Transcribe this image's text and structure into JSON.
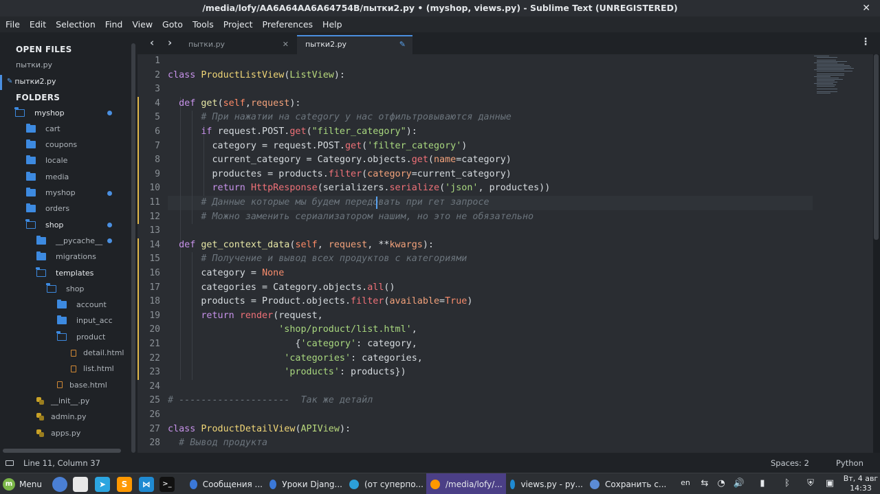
{
  "window": {
    "title": "/media/lofy/AA6A64AA6A64754B/пытки2.py • (myshop, views.py) - Sublime Text (UNREGISTERED)",
    "close_glyph": "✕"
  },
  "menu": [
    "File",
    "Edit",
    "Selection",
    "Find",
    "View",
    "Goto",
    "Tools",
    "Project",
    "Preferences",
    "Help"
  ],
  "sidebar": {
    "open_files_header": "OPEN FILES",
    "open_files": [
      {
        "label": "пытки.ру",
        "active": false
      },
      {
        "label": "пытки2.ру",
        "active": true
      }
    ],
    "folders_header": "FOLDERS",
    "tree": [
      {
        "label": "myshop",
        "type": "folder-open",
        "depth": 0,
        "dot": true
      },
      {
        "label": "cart",
        "type": "folder",
        "depth": 1,
        "dot": false
      },
      {
        "label": "coupons",
        "type": "folder",
        "depth": 1,
        "dot": false
      },
      {
        "label": "locale",
        "type": "folder",
        "depth": 1,
        "dot": false
      },
      {
        "label": "media",
        "type": "folder",
        "depth": 1,
        "dot": false
      },
      {
        "label": "myshop",
        "type": "folder",
        "depth": 1,
        "dot": true
      },
      {
        "label": "orders",
        "type": "folder",
        "depth": 1,
        "dot": false
      },
      {
        "label": "shop",
        "type": "folder-open",
        "depth": 1,
        "dot": true
      },
      {
        "label": "__pycache__",
        "type": "folder",
        "depth": 2,
        "dot": true
      },
      {
        "label": "migrations",
        "type": "folder",
        "depth": 2,
        "dot": false
      },
      {
        "label": "templates",
        "type": "folder-open",
        "depth": 2,
        "dot": false
      },
      {
        "label": "shop",
        "type": "folder-open",
        "depth": 3,
        "dot": false
      },
      {
        "label": "account",
        "type": "folder",
        "depth": 4,
        "dot": false
      },
      {
        "label": "input_acc",
        "type": "folder",
        "depth": 4,
        "dot": false
      },
      {
        "label": "product",
        "type": "folder-open",
        "depth": 4,
        "dot": false
      },
      {
        "label": "detail.html",
        "type": "html",
        "depth": 5,
        "dot": false
      },
      {
        "label": "list.html",
        "type": "html",
        "depth": 5,
        "dot": false
      },
      {
        "label": "base.html",
        "type": "html",
        "depth": 4,
        "dot": false
      },
      {
        "label": "__init__.py",
        "type": "py",
        "depth": 2,
        "dot": false
      },
      {
        "label": "admin.py",
        "type": "py",
        "depth": 2,
        "dot": false
      },
      {
        "label": "apps.py",
        "type": "py",
        "depth": 2,
        "dot": false
      }
    ]
  },
  "tabs": [
    {
      "label": "пытки.ру",
      "active": false
    },
    {
      "label": "пытки2.ру",
      "active": true
    }
  ],
  "editor": {
    "current_line": 11,
    "modified_lines": [
      4,
      5,
      6,
      7,
      8,
      9,
      10,
      11,
      12,
      14,
      15,
      16,
      17,
      18,
      19,
      20,
      21,
      22,
      23
    ],
    "lines": [
      {
        "n": 1,
        "tokens": []
      },
      {
        "n": 2,
        "tokens": [
          [
            "kw",
            "class "
          ],
          [
            "cls",
            "ProductListView"
          ],
          [
            "op",
            "("
          ],
          [
            "cls2",
            "ListView"
          ],
          [
            "op",
            "):"
          ]
        ]
      },
      {
        "n": 3,
        "tokens": []
      },
      {
        "n": 4,
        "tokens": [
          [
            "op",
            "  "
          ],
          [
            "kw",
            "def "
          ],
          [
            "fn",
            "get"
          ],
          [
            "op",
            "("
          ],
          [
            "self",
            "self"
          ],
          [
            "op",
            ","
          ],
          [
            "param",
            "request"
          ],
          [
            "op",
            "):"
          ]
        ]
      },
      {
        "n": 5,
        "tokens": [
          [
            "op",
            "      "
          ],
          [
            "cmt",
            "# При нажатии на category у нас отфильтровываются данные"
          ]
        ]
      },
      {
        "n": 6,
        "tokens": [
          [
            "op",
            "      "
          ],
          [
            "kw",
            "if "
          ],
          [
            "op",
            "request.POST."
          ],
          [
            "call",
            "get"
          ],
          [
            "op",
            "("
          ],
          [
            "str",
            "\"filter_category\""
          ],
          [
            "op",
            "):"
          ]
        ]
      },
      {
        "n": 7,
        "tokens": [
          [
            "op",
            "        category = request.POST."
          ],
          [
            "call",
            "get"
          ],
          [
            "op",
            "("
          ],
          [
            "str",
            "'filter_category'"
          ],
          [
            "op",
            ")"
          ]
        ]
      },
      {
        "n": 8,
        "tokens": [
          [
            "op",
            "        current_category = Category.objects."
          ],
          [
            "call",
            "get"
          ],
          [
            "op",
            "("
          ],
          [
            "param",
            "name"
          ],
          [
            "op",
            "=category)"
          ]
        ]
      },
      {
        "n": 9,
        "tokens": [
          [
            "op",
            "        productes = products."
          ],
          [
            "call",
            "filter"
          ],
          [
            "op",
            "("
          ],
          [
            "param",
            "category"
          ],
          [
            "op",
            "=current_category)"
          ]
        ]
      },
      {
        "n": 10,
        "tokens": [
          [
            "op",
            "        "
          ],
          [
            "kw",
            "return "
          ],
          [
            "call",
            "HttpResponse"
          ],
          [
            "op",
            "(serializers."
          ],
          [
            "call",
            "serialize"
          ],
          [
            "op",
            "("
          ],
          [
            "str",
            "'json'"
          ],
          [
            "op",
            ", productes))"
          ]
        ]
      },
      {
        "n": 11,
        "tokens": [
          [
            "op",
            "      "
          ],
          [
            "cmt",
            "# Данные которые мы будем передовать при гет запросе"
          ]
        ]
      },
      {
        "n": 12,
        "tokens": [
          [
            "op",
            "      "
          ],
          [
            "cmt",
            "# Можно заменить сериализатором нашим, но это не обязательно"
          ]
        ]
      },
      {
        "n": 13,
        "tokens": []
      },
      {
        "n": 14,
        "tokens": [
          [
            "op",
            "  "
          ],
          [
            "kw",
            "def "
          ],
          [
            "fn",
            "get_context_data"
          ],
          [
            "op",
            "("
          ],
          [
            "self",
            "self"
          ],
          [
            "op",
            ", "
          ],
          [
            "param",
            "request"
          ],
          [
            "op",
            ", **"
          ],
          [
            "param",
            "kwargs"
          ],
          [
            "op",
            "):"
          ]
        ]
      },
      {
        "n": 15,
        "tokens": [
          [
            "op",
            "      "
          ],
          [
            "cmt",
            "# Получение и вывод всех продуктов с категориями"
          ]
        ]
      },
      {
        "n": 16,
        "tokens": [
          [
            "op",
            "      category = "
          ],
          [
            "const",
            "None"
          ]
        ]
      },
      {
        "n": 17,
        "tokens": [
          [
            "op",
            "      categories = Category.objects."
          ],
          [
            "call",
            "all"
          ],
          [
            "op",
            "()"
          ]
        ]
      },
      {
        "n": 18,
        "tokens": [
          [
            "op",
            "      products = Product.objects."
          ],
          [
            "call",
            "filter"
          ],
          [
            "op",
            "("
          ],
          [
            "param",
            "available"
          ],
          [
            "op",
            "="
          ],
          [
            "const",
            "True"
          ],
          [
            "op",
            ")"
          ]
        ]
      },
      {
        "n": 19,
        "tokens": [
          [
            "op",
            "      "
          ],
          [
            "kw",
            "return "
          ],
          [
            "call",
            "render"
          ],
          [
            "op",
            "(request,"
          ]
        ]
      },
      {
        "n": 20,
        "tokens": [
          [
            "op",
            "                    "
          ],
          [
            "str",
            "'shop/product/list.html'"
          ],
          [
            "op",
            ","
          ]
        ]
      },
      {
        "n": 21,
        "tokens": [
          [
            "op",
            "                       {"
          ],
          [
            "str",
            "'category'"
          ],
          [
            "op",
            ": category,"
          ]
        ]
      },
      {
        "n": 22,
        "tokens": [
          [
            "op",
            "                     "
          ],
          [
            "str",
            "'categories'"
          ],
          [
            "op",
            ": categories,"
          ]
        ]
      },
      {
        "n": 23,
        "tokens": [
          [
            "op",
            "                     "
          ],
          [
            "str",
            "'products'"
          ],
          [
            "op",
            ": products})"
          ]
        ]
      },
      {
        "n": 24,
        "tokens": []
      },
      {
        "n": 25,
        "tokens": [
          [
            "cmt",
            "# --------------------  Так же детайл"
          ]
        ]
      },
      {
        "n": 26,
        "tokens": []
      },
      {
        "n": 27,
        "tokens": [
          [
            "kw",
            "class "
          ],
          [
            "cls",
            "ProductDetailView"
          ],
          [
            "op",
            "("
          ],
          [
            "cls2",
            "APIView"
          ],
          [
            "op",
            "):"
          ]
        ]
      },
      {
        "n": 28,
        "tokens": [
          [
            "op",
            "  "
          ],
          [
            "cmt",
            "# Вывод продукта"
          ]
        ]
      }
    ]
  },
  "statusbar": {
    "position": "Line 11, Column 37",
    "spaces": "Spaces: 2",
    "syntax": "Python"
  },
  "taskbar": {
    "menu_label": "Menu",
    "windows": [
      {
        "label": "Сообщения ...",
        "color": "#3b78d8",
        "active": false
      },
      {
        "label": "Уроки Djang...",
        "color": "#3b78d8",
        "active": false
      },
      {
        "label": "(от суперпо...",
        "color": "#2c9fd9",
        "active": false
      },
      {
        "label": "/media/lofy/...",
        "color": "#ff9800",
        "active": true
      },
      {
        "label": "views.py - ру...",
        "color": "#1f8ad2",
        "active": false
      },
      {
        "label": "Сохранить с...",
        "color": "#5b8bd6",
        "active": false
      }
    ],
    "lang": "en",
    "clock_day": "Вт, 4 авг",
    "clock_time": "14:33"
  }
}
